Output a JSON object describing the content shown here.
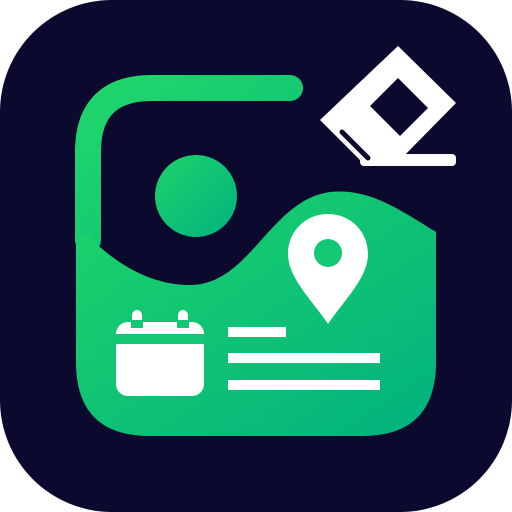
{
  "app_icon": {
    "icon": "photo-metadata-eraser-icon",
    "colors": {
      "background": "#0B0A2E",
      "accent_start": "#20D46E",
      "accent_end": "#00B27F",
      "foreground": "#FFFFFF",
      "dark": "#0B0A2E"
    },
    "glyphs": [
      "image-frame-icon",
      "sun-icon",
      "map-pin-icon",
      "calendar-icon",
      "text-lines-icon",
      "eraser-icon"
    ]
  }
}
